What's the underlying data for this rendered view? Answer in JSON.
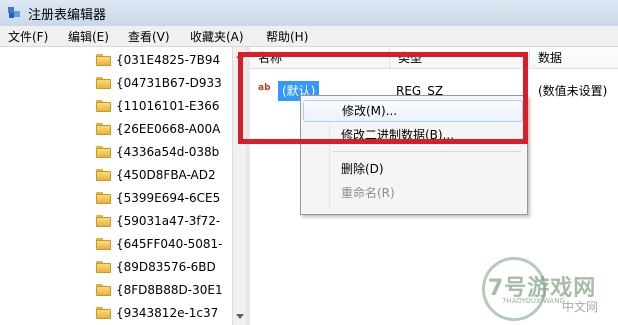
{
  "window": {
    "title": "注册表编辑器"
  },
  "menu": [
    "文件(F)",
    "编辑(E)",
    "查看(V)",
    "收藏夹(A)",
    "帮助(H)"
  ],
  "tree": {
    "items": [
      "{031E4825-7B94",
      "{04731B67-D933",
      "{11016101-E366",
      "{26EE0668-A00A",
      "{4336a54d-038b",
      "{450D8FBA-AD2",
      "{5399E694-6CE5",
      "{59031a47-3f72-",
      "{645FF040-5081-",
      "{89D83576-6BD",
      "{8FD8B88D-30E1",
      "{9343812e-1c37"
    ]
  },
  "list": {
    "headers": {
      "name": "名称",
      "type": "类型",
      "data": "数据"
    },
    "rows": [
      {
        "icon": "ab",
        "name": "(默认)",
        "type": "REG_SZ",
        "data": "(数值未设置)"
      }
    ]
  },
  "context_menu": {
    "items": [
      {
        "label": "修改(M)...",
        "state": "hover"
      },
      {
        "label": "修改二进制数据(B)...",
        "state": "normal"
      },
      {
        "label": "删除(D)",
        "state": "normal"
      },
      {
        "label": "重命名(R)",
        "state": "disabled"
      }
    ]
  },
  "watermark": {
    "brand": "7号游戏网",
    "sub": "7HAOYOUXIWANG",
    "site": "中文网"
  },
  "colors": {
    "highlight": "#d71f27",
    "selection": "#3399ff"
  }
}
